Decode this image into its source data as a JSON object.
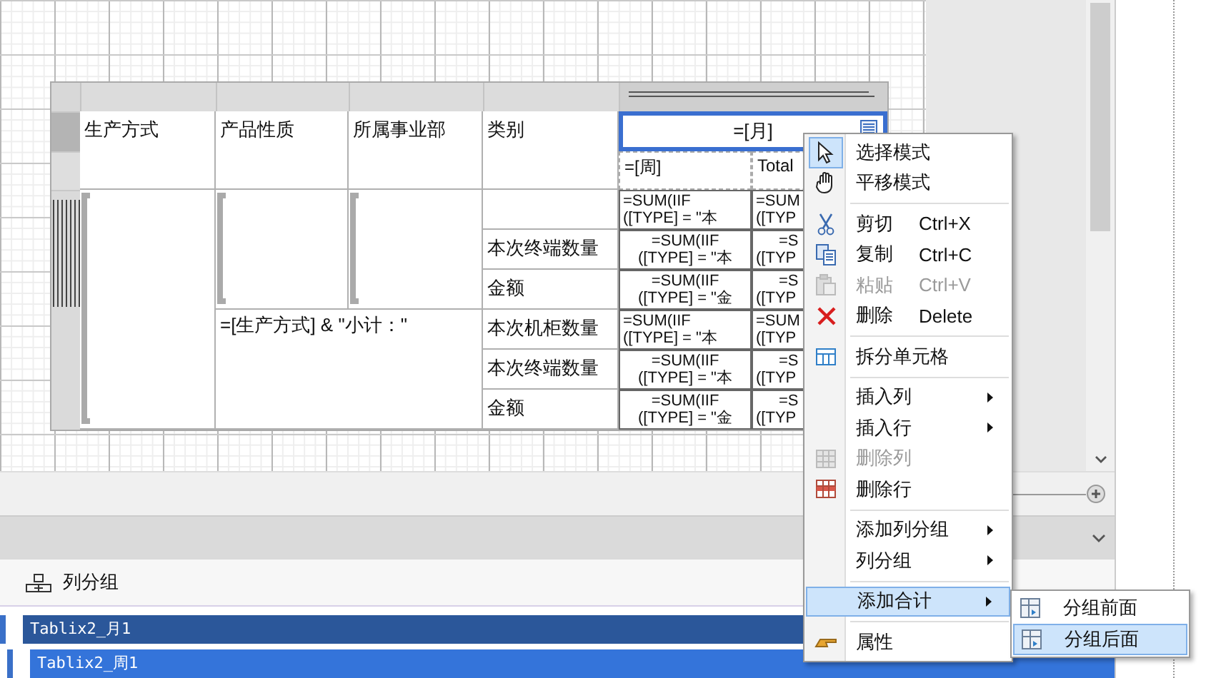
{
  "table": {
    "headers": [
      "生产方式",
      "产品性质",
      "所属事业部",
      "类别"
    ],
    "month_cell": "=[月]",
    "week_cell": "=[周]",
    "total_cell": "Total",
    "subtotal_label": "=[生产方式] & \"小计：\"",
    "rows": [
      {
        "category": "",
        "kind": "plain",
        "cells": [
          [
            "=SUM(IIF",
            "([TYPE] = \"本"
          ],
          [
            "=SUM",
            "([TYP"
          ]
        ]
      },
      {
        "category": "本次终端数量",
        "kind": "centered",
        "cells": [
          [
            "=SUM(IIF",
            "([TYPE] = \"本"
          ],
          [
            "=S",
            "([TYP"
          ]
        ]
      },
      {
        "category": "金额",
        "kind": "centered",
        "cells": [
          [
            "=SUM(IIF",
            "([TYPE] = \"金"
          ],
          [
            "=S",
            "([TYP"
          ]
        ]
      },
      {
        "category": "本次机柜数量",
        "kind": "plain",
        "cells": [
          [
            "=SUM(IIF",
            "([TYPE] = \"本"
          ],
          [
            "=SUM",
            "([TYP"
          ]
        ]
      },
      {
        "category": "本次终端数量",
        "kind": "centered",
        "cells": [
          [
            "=SUM(IIF",
            "([TYPE] = \"本"
          ],
          [
            "=S",
            "([TYP"
          ]
        ]
      },
      {
        "category": "金额",
        "kind": "centered",
        "cells": [
          [
            "=SUM(IIF",
            "([TYPE] = \"金"
          ],
          [
            "=S",
            "([TYP"
          ]
        ]
      }
    ]
  },
  "column_groups": {
    "title": "列分组",
    "groups": [
      {
        "label": "Tablix2_月1",
        "selected": false,
        "children": [
          {
            "label": "Tablix2_周1",
            "selected": true
          }
        ]
      }
    ]
  },
  "context_menu": [
    {
      "kind": "item",
      "label": "选择模式",
      "selected": true,
      "disabled": false
    },
    {
      "kind": "item",
      "label": "平移模式",
      "selected": false,
      "disabled": false
    },
    {
      "kind": "separator"
    },
    {
      "kind": "item",
      "label": "剪切",
      "shortcut": "Ctrl+X",
      "selected": false,
      "disabled": false
    },
    {
      "kind": "item",
      "label": "复制",
      "shortcut": "Ctrl+C",
      "selected": false,
      "disabled": false
    },
    {
      "kind": "item",
      "label": "粘贴",
      "shortcut": "Ctrl+V",
      "selected": false,
      "disabled": true
    },
    {
      "kind": "item",
      "label": "删除",
      "shortcut": "Delete",
      "selected": false,
      "disabled": false
    },
    {
      "kind": "separator"
    },
    {
      "kind": "item",
      "label": "拆分单元格",
      "selected": false,
      "disabled": false
    },
    {
      "kind": "separator"
    },
    {
      "kind": "item",
      "label": "插入列",
      "submenu": true,
      "selected": false,
      "disabled": false
    },
    {
      "kind": "item",
      "label": "插入行",
      "submenu": true,
      "selected": false,
      "disabled": false
    },
    {
      "kind": "item",
      "label": "删除列",
      "selected": false,
      "disabled": true
    },
    {
      "kind": "item",
      "label": "删除行",
      "selected": false,
      "disabled": false
    },
    {
      "kind": "separator"
    },
    {
      "kind": "item",
      "label": "添加列分组",
      "submenu": true,
      "selected": false,
      "disabled": false
    },
    {
      "kind": "item",
      "label": "列分组",
      "submenu": true,
      "selected": false,
      "disabled": false
    },
    {
      "kind": "separator"
    },
    {
      "kind": "item",
      "label": "添加合计",
      "submenu": true,
      "selected": true,
      "disabled": false
    },
    {
      "kind": "separator"
    },
    {
      "kind": "item",
      "label": "属性",
      "selected": false,
      "disabled": false
    }
  ],
  "submenu": [
    {
      "label": "分组前面",
      "selected": false
    },
    {
      "label": "分组后面",
      "selected": true
    }
  ]
}
